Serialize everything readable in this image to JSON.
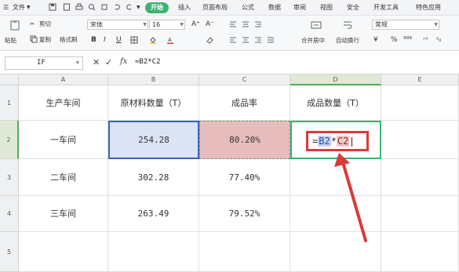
{
  "menu": {
    "file": "文件",
    "tabs": [
      "开始",
      "插入",
      "页面布局",
      "公式",
      "数据",
      "审阅",
      "视图",
      "安全",
      "开发工具",
      "特色应用"
    ]
  },
  "ribbon": {
    "cut": "剪切",
    "paste": "粘贴",
    "copy": "复制",
    "format_painter": "格式刷",
    "font_name": "宋体",
    "font_size": "16",
    "bold": "B",
    "italic": "I",
    "underline": "U",
    "merge_center": "合并居中",
    "wrap_text": "自动换行",
    "number_format": "常规"
  },
  "formula_bar": {
    "name_box": "IF",
    "fx": "fx",
    "formula": "=B2*C2"
  },
  "columns": [
    "A",
    "B",
    "C",
    "D",
    "E"
  ],
  "rows": [
    "1",
    "2",
    "3",
    "4",
    "5"
  ],
  "headers": {
    "A1": "生产车间",
    "B1": "原材料数量（T）",
    "C1": "成品率",
    "D1": "成品数量（T）"
  },
  "data_rows": [
    {
      "workshop": "一车间",
      "material": "254.28",
      "yield": "80.20%"
    },
    {
      "workshop": "二车间",
      "material": "302.28",
      "yield": "77.40%"
    },
    {
      "workshop": "三车间",
      "material": "263.49",
      "yield": "79.52%"
    }
  ],
  "editing": {
    "eq": "=",
    "ref1": "B2",
    "op": "*",
    "ref2": "C2"
  },
  "colors": {
    "ref_b2": "#3b64b8",
    "ref_c2": "#e6bcbc",
    "active_cell": "#3cb371",
    "annotation": "#d93a3a"
  }
}
